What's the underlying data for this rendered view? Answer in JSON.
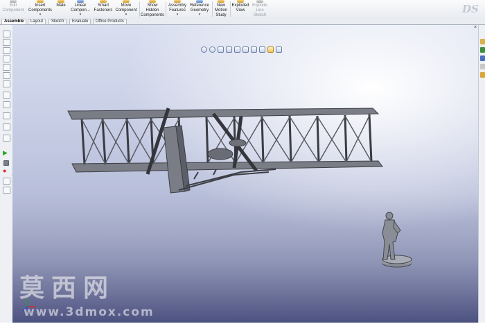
{
  "ribbon": {
    "buttons": [
      {
        "label": "Edit Component",
        "disabled": true
      },
      {
        "label": "Insert Components",
        "arrow": true
      },
      {
        "label": "Mate"
      },
      {
        "label": "Linear Compon...",
        "arrow": true
      },
      {
        "label": "Smart Fasteners"
      },
      {
        "label": "Move Component",
        "arrow": true
      },
      {
        "label": "Show Hidden Components"
      },
      {
        "label": "Assembly Features",
        "arrow": true
      },
      {
        "label": "Reference Geometry",
        "arrow": true
      },
      {
        "label": "New Motion Study"
      },
      {
        "label": "Exploded View"
      },
      {
        "label": "Explode Line Sketch",
        "disabled": true
      }
    ]
  },
  "tabs": [
    "Assemble",
    "Layout",
    "Sketch",
    "Evaluate",
    "Office Products"
  ],
  "active_tab": "Assemble",
  "heads_up_toolbar": {
    "icons": [
      "zoom-to-fit-icon",
      "zoom-to-area-icon",
      "previous-view-icon",
      "section-view-icon",
      "view-orientation-icon",
      "display-style-icon",
      "hide-show-items-icon",
      "edit-appearance-icon",
      "apply-scene-icon",
      "view-settings-icon"
    ]
  },
  "watermark": {
    "chinese": "莫西网",
    "url": "www.3dmox.com"
  },
  "colors": {
    "viewport_top": "#d9dff0",
    "viewport_bottom": "#5c6291",
    "model_fill": "#7b7d86",
    "model_stroke": "#3c3e45"
  },
  "panel_close": "×"
}
